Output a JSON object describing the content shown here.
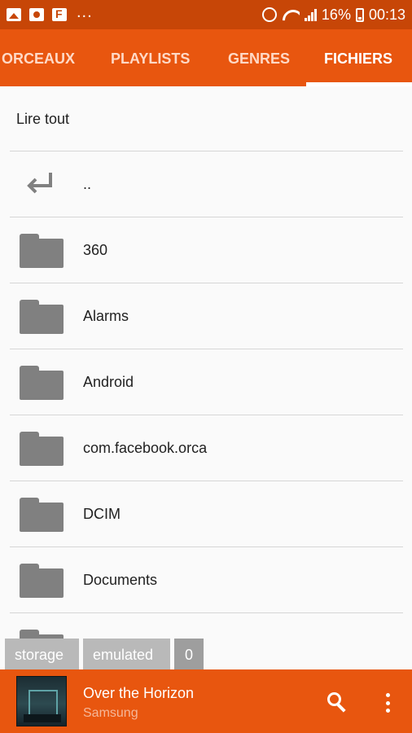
{
  "status_bar": {
    "battery": "16%",
    "time": "00:13",
    "overflow": "..."
  },
  "tabs": [
    {
      "label": "ORCEAUX",
      "active": false
    },
    {
      "label": "PLAYLISTS",
      "active": false
    },
    {
      "label": "GENRES",
      "active": false
    },
    {
      "label": "FICHIERS",
      "active": true
    }
  ],
  "file_browser": {
    "play_all_label": "Lire tout",
    "parent_label": "..",
    "folders": [
      "360",
      "Alarms",
      "Android",
      "com.facebook.orca",
      "DCIM",
      "Documents"
    ]
  },
  "breadcrumb": [
    "storage",
    "emulated",
    "0"
  ],
  "now_playing": {
    "title": "Over the Horizon",
    "artist": "Samsung"
  },
  "colors": {
    "accent": "#e8560f",
    "status_bar": "#c74607",
    "folder_icon": "#808080"
  }
}
